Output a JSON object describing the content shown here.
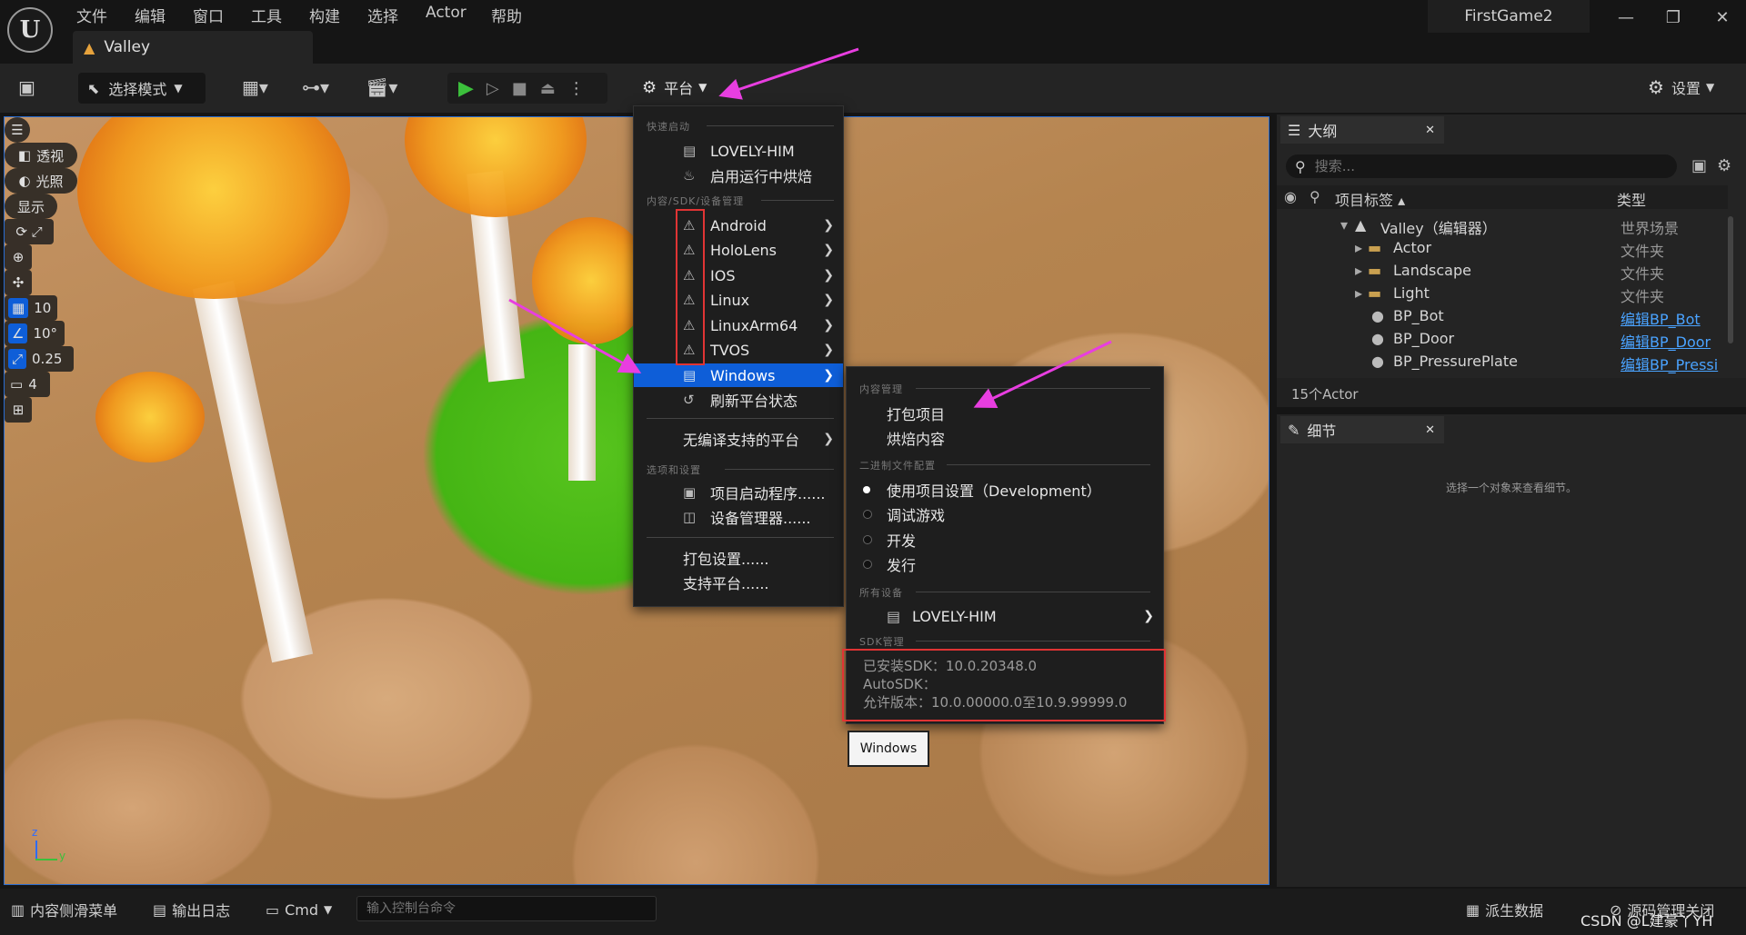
{
  "menubar": {
    "items": [
      "文件",
      "编辑",
      "窗口",
      "工具",
      "构建",
      "选择",
      "Actor",
      "帮助"
    ],
    "project_name": "FirstGame2",
    "win_minimize": "—",
    "win_restore": "❐",
    "win_close": "✕"
  },
  "level_tab": {
    "label": "Valley"
  },
  "toolbar": {
    "mode_label": "选择模式",
    "platform_label": "平台",
    "settings_label": "设置"
  },
  "viewport": {
    "perspective_label": "透视",
    "lighting_label": "光照",
    "show_label": "显示",
    "grid_value": "10",
    "rotation_value": "10°",
    "scale_value": "0.25",
    "camera_speed": "4",
    "axis_z": "z",
    "axis_y": "y"
  },
  "platform_menu": {
    "section_quick_launch": "快速启动",
    "device": "LOVELY-HIM",
    "enable_cook": "启用运行中烘焙",
    "section_content_sdk": "内容/SDK/设备管理",
    "platforms": [
      "Android",
      "HoloLens",
      "IOS",
      "Linux",
      "LinuxArm64",
      "TVOS"
    ],
    "windows": "Windows",
    "refresh": "刷新平台状态",
    "no_compile": "无编译支持的平台",
    "section_options": "选项和设置",
    "launcher": "项目启动程序......",
    "device_manager": "设备管理器......",
    "package_settings": "打包设置......",
    "supported_platforms": "支持平台......"
  },
  "windows_submenu": {
    "section_content": "内容管理",
    "package_project": "打包项目",
    "cook_content": "烘焙内容",
    "section_binary": "二进制文件配置",
    "configs": [
      "使用项目设置（Development）",
      "调试游戏",
      "开发",
      "发行"
    ],
    "section_devices": "所有设备",
    "device": "LOVELY-HIM",
    "section_sdk": "SDK管理",
    "installed_sdk": "已安装SDK：10.0.20348.0",
    "auto_sdk": "AutoSDK：",
    "allowed_version": "允许版本：10.0.00000.0至10.9.99999.0",
    "tooltip": "Windows"
  },
  "outliner": {
    "tab_label": "大纲",
    "search_placeholder": "搜索...",
    "col_label": "项目标签 ▴",
    "col_type": "类型",
    "rows": [
      {
        "name": "Valley（编辑器）",
        "type": "世界场景"
      },
      {
        "name": "Actor",
        "type": "文件夹"
      },
      {
        "name": "Landscape",
        "type": "文件夹"
      },
      {
        "name": "Light",
        "type": "文件夹"
      },
      {
        "name": "BP_Bot",
        "type": "编辑BP_Bot"
      },
      {
        "name": "BP_Door",
        "type": "编辑BP_Door"
      },
      {
        "name": "BP_PressurePlate",
        "type": "编辑BP_Pressi"
      }
    ],
    "actor_count": "15个Actor"
  },
  "details": {
    "tab_label": "细节",
    "empty_hint": "选择一个对象来查看细节。"
  },
  "bottombar": {
    "content_drawer": "内容侧滑菜单",
    "output_log": "输出日志",
    "cmd": "Cmd",
    "console_placeholder": "输入控制台命令",
    "derived_data": "派生数据",
    "source_control": "源码管理关闭",
    "watermark": "CSDN @L建豪丫YH"
  },
  "colors": {
    "accent": "#0e5ed8",
    "highlight": "#e03434",
    "arrow": "#e83ee0",
    "play": "#3cc03c"
  }
}
